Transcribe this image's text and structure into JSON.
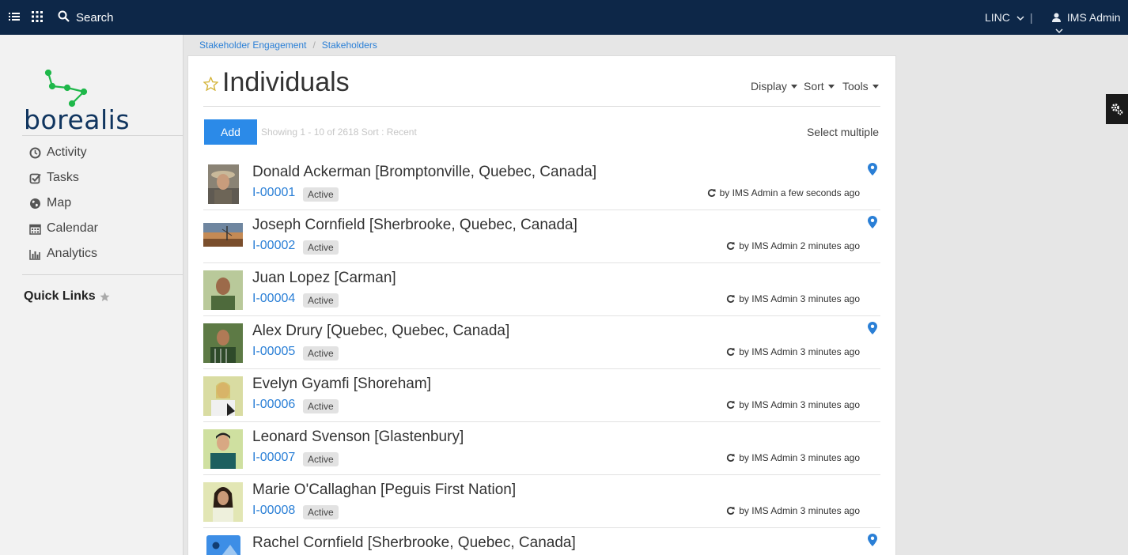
{
  "topbar": {
    "menu_icon": "list-icon",
    "apps_icon": "grid-icon",
    "search_icon": "search-icon",
    "search_label": "Search",
    "org": "LINC",
    "user": "IMS Admin",
    "user_icon": "user-icon",
    "bg_color": "#0d2748"
  },
  "sidebar": {
    "logo_text": "borealis",
    "nav": [
      {
        "label": "Activity",
        "icon": "clock-icon"
      },
      {
        "label": "Tasks",
        "icon": "checkbox-icon"
      },
      {
        "label": "Map",
        "icon": "globe-icon"
      },
      {
        "label": "Calendar",
        "icon": "calendar-icon"
      },
      {
        "label": "Analytics",
        "icon": "bar-chart-icon"
      }
    ],
    "quick_links": "Quick Links"
  },
  "breadcrumb": [
    "Stakeholder Engagement",
    "Stakeholders"
  ],
  "main": {
    "title": "Individuals",
    "menus": [
      "Display",
      "Sort",
      "Tools"
    ],
    "add_label": "Add",
    "showing_text": "Showing 1 - 10 of 2618  Sort :   Recent",
    "select_multiple": "Select multiple",
    "accent_color": "#2b8ae8",
    "rows": [
      {
        "name": "Donald Ackerman [Bromptonville, Quebec, Canada]",
        "id": "I-00001",
        "status": "Active",
        "updated": "by IMS Admin a few seconds ago",
        "pin": true
      },
      {
        "name": "Joseph Cornfield [Sherbrooke, Quebec, Canada]",
        "id": "I-00002",
        "status": "Active",
        "updated": "by IMS Admin 2 minutes ago",
        "pin": true
      },
      {
        "name": "Juan Lopez [Carman]",
        "id": "I-00004",
        "status": "Active",
        "updated": "by IMS Admin 3 minutes ago",
        "pin": false
      },
      {
        "name": "Alex Drury [Quebec, Quebec, Canada]",
        "id": "I-00005",
        "status": "Active",
        "updated": "by IMS Admin 3 minutes ago",
        "pin": true
      },
      {
        "name": "Evelyn Gyamfi [Shoreham]",
        "id": "I-00006",
        "status": "Active",
        "updated": "by IMS Admin 3 minutes ago",
        "pin": false
      },
      {
        "name": "Leonard Svenson [Glastenbury]",
        "id": "I-00007",
        "status": "Active",
        "updated": "by IMS Admin 3 minutes ago",
        "pin": false
      },
      {
        "name": "Marie O'Callaghan [Peguis First Nation]",
        "id": "I-00008",
        "status": "Active",
        "updated": "by IMS Admin 3 minutes ago",
        "pin": false
      },
      {
        "name": "Rachel Cornfield [Sherbrooke, Quebec, Canada]",
        "id": "",
        "status": "",
        "updated": "",
        "pin": true
      }
    ]
  }
}
